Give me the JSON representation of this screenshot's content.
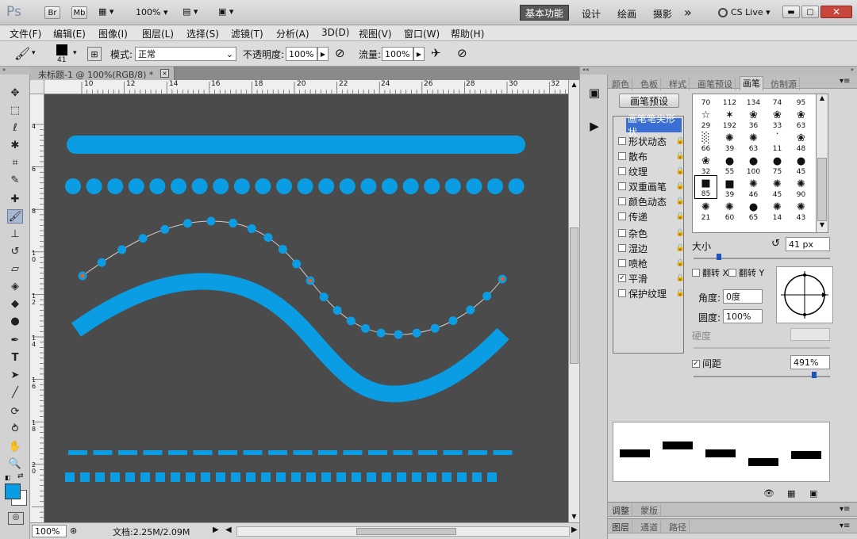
{
  "title_bar": {
    "logo": "Ps",
    "buttons": [
      "Br",
      "Mb"
    ],
    "zoom": "100%",
    "workspaces": [
      "基本功能",
      "设计",
      "绘画",
      "摄影"
    ],
    "more": "»",
    "cs_live": "CS Live",
    "window_controls": [
      "minimize-icon",
      "restore-icon",
      "close-icon"
    ]
  },
  "menu": [
    "文件(F)",
    "编辑(E)",
    "图像(I)",
    "图层(L)",
    "选择(S)",
    "滤镜(T)",
    "分析(A)",
    "3D(D)",
    "视图(V)",
    "窗口(W)",
    "帮助(H)"
  ],
  "options": {
    "brush_size": "41",
    "mode_label": "模式:",
    "mode_value": "正常",
    "opacity_label": "不透明度:",
    "opacity_value": "100%",
    "flow_label": "流量:",
    "flow_value": "100%"
  },
  "document": {
    "tab_title": "未标题-1 @ 100%(RGB/8) *",
    "ruler_top": [
      "10",
      "12",
      "14",
      "16",
      "18",
      "20",
      "22",
      "24",
      "26",
      "28",
      "30",
      "32"
    ],
    "ruler_left": [
      "4",
      "6",
      "8",
      "1\n0",
      "1\n2",
      "1\n4",
      "1\n6",
      "1\n8",
      "2\n0"
    ],
    "status_zoom": "100%",
    "status_doc": "文档:2.25M/2.09M",
    "canvas_bg": "#4b4b4b",
    "stroke_color": "#0b9de3",
    "anchor_color": "#e8601c"
  },
  "panel": {
    "top_tabs": [
      "颜色",
      "色板",
      "样式",
      "画笔预设",
      "画笔",
      "仿制源"
    ],
    "active_tab": "画笔",
    "preset_button": "画笔预设",
    "brush_options": [
      {
        "label": "画笔笔尖形状",
        "checked": false,
        "selected": true
      },
      {
        "label": "形状动态",
        "checked": false
      },
      {
        "label": "散布",
        "checked": false
      },
      {
        "label": "纹理",
        "checked": false
      },
      {
        "label": "双重画笔",
        "checked": false
      },
      {
        "label": "颜色动态",
        "checked": false
      },
      {
        "label": "传递",
        "checked": false
      },
      {
        "label": "杂色",
        "checked": false
      },
      {
        "label": "湿边",
        "checked": false
      },
      {
        "label": "喷枪",
        "checked": false
      },
      {
        "label": "平滑",
        "checked": true
      },
      {
        "label": "保护纹理",
        "checked": false
      }
    ],
    "brush_grid": [
      [
        "70",
        "112",
        "134",
        "74",
        "95"
      ],
      [
        "29",
        "192",
        "36",
        "33",
        "63"
      ],
      [
        "66",
        "39",
        "63",
        "11",
        "48"
      ],
      [
        "32",
        "55",
        "100",
        "75",
        "45"
      ],
      [
        "85",
        "39",
        "46",
        "45",
        "90"
      ],
      [
        "21",
        "60",
        "65",
        "14",
        "43"
      ]
    ],
    "size_label": "大小",
    "size_value": "41 px",
    "flip_x": "翻转 X",
    "flip_y": "翻转 Y",
    "angle_label": "角度:",
    "angle_value": "0度",
    "roundness_label": "圆度:",
    "roundness_value": "100%",
    "hardness_label": "硬度",
    "spacing_label": "间距",
    "spacing_value": "491%",
    "bottom_tabs_1": [
      "调整",
      "蒙版"
    ],
    "bottom_tabs_2": [
      "图层",
      "通道",
      "路径"
    ]
  }
}
